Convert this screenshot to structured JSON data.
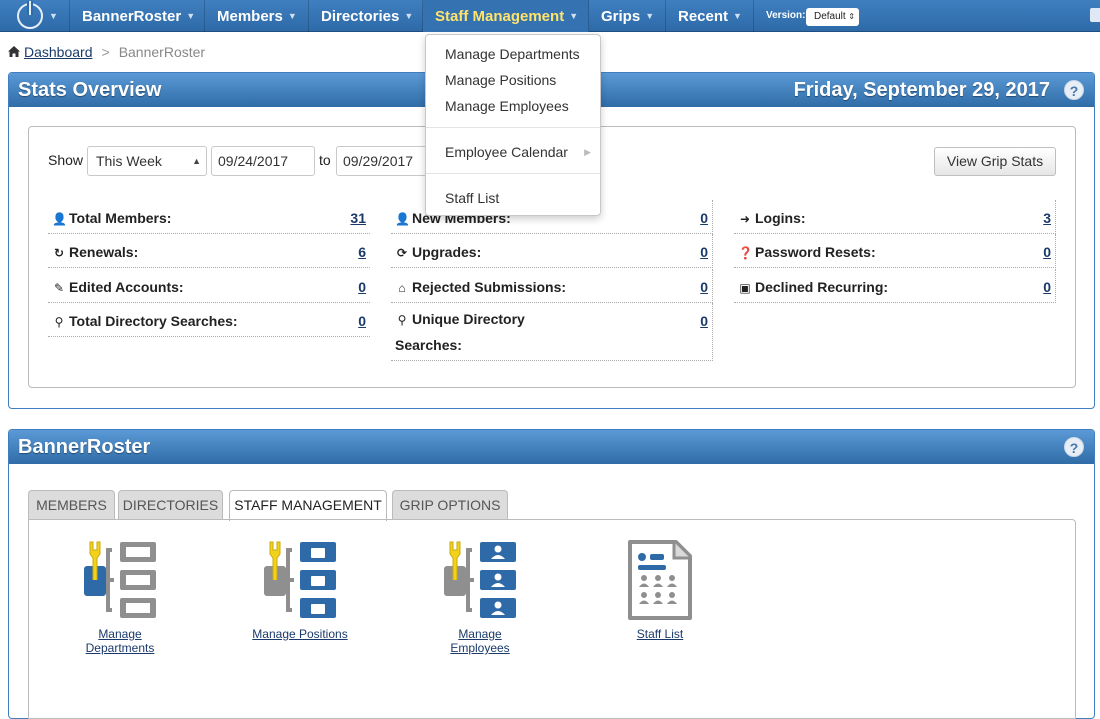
{
  "nav": {
    "items": [
      {
        "label": "BannerRoster"
      },
      {
        "label": "Members"
      },
      {
        "label": "Directories"
      },
      {
        "label": "Staff Management"
      },
      {
        "label": "Grips"
      },
      {
        "label": "Recent"
      }
    ],
    "version_label": "Version:",
    "version_value": "Default"
  },
  "breadcrumb": {
    "home": "Dashboard",
    "separator": ">",
    "current": "BannerRoster"
  },
  "dropdown": {
    "items": [
      {
        "label": "Manage Departments"
      },
      {
        "label": "Manage Positions"
      },
      {
        "label": "Manage Employees"
      },
      {
        "label": "Employee Calendar"
      },
      {
        "label": "Staff List"
      }
    ]
  },
  "stats": {
    "title": "Stats Overview",
    "date": "Friday, September 29, 2017",
    "help": "?",
    "show_label": "Show",
    "period": "This Week",
    "from_date": "09/24/2017",
    "to_label": "to",
    "to_date": "09/29/2017",
    "grip_button": "View Grip Stats",
    "rows": [
      {
        "label": "Total Members:",
        "value": "31",
        "icon": "user-icon"
      },
      {
        "label": "New Members:",
        "value": "0",
        "icon": "user-icon"
      },
      {
        "label": "Logins:",
        "value": "3",
        "icon": "sign-in-icon"
      },
      {
        "label": "Renewals:",
        "value": "6",
        "icon": "refresh-icon"
      },
      {
        "label": "Upgrades:",
        "value": "0",
        "icon": "refresh-icon"
      },
      {
        "label": "Password Resets:",
        "value": "0",
        "icon": "question-circle-icon"
      },
      {
        "label": "Edited Accounts:",
        "value": "0",
        "icon": "pencil-icon"
      },
      {
        "label": "Rejected Submissions:",
        "value": "0",
        "icon": "inbox-icon"
      },
      {
        "label": "Declined Recurring:",
        "value": "0",
        "icon": "money-icon"
      },
      {
        "label": "Total Directory Searches:",
        "value": "0",
        "icon": "search-icon"
      },
      {
        "label": "Unique Directory",
        "label2": "Searches:",
        "value": "0",
        "icon": "search-icon"
      }
    ]
  },
  "banner": {
    "title": "BannerRoster",
    "help": "?",
    "tabs": [
      {
        "label": "MEMBERS"
      },
      {
        "label": "DIRECTORIES"
      },
      {
        "label": "STAFF MANAGEMENT"
      },
      {
        "label": "GRIP OPTIONS"
      }
    ],
    "tools": [
      {
        "line1": "Manage",
        "line2": "Departments"
      },
      {
        "line1": "Manage Positions",
        "line2": ""
      },
      {
        "line1": "Manage",
        "line2": "Employees"
      },
      {
        "line1": "Staff List",
        "line2": ""
      }
    ]
  },
  "colors": {
    "nav_blue": "#2e6aa8",
    "active_nav": "#ffe36b",
    "link": "#1a3a6b",
    "panel_header": "#3f7fc0"
  }
}
